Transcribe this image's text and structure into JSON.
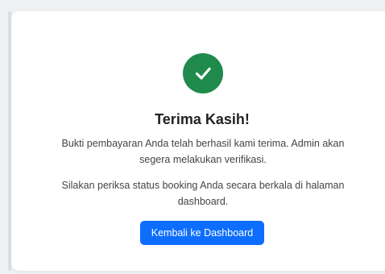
{
  "confirmation": {
    "icon": "check-circle-icon",
    "icon_color": "#1f8a4c",
    "title": "Terima Kasih!",
    "message_1": "Bukti pembayaran Anda telah berhasil kami terima. Admin akan segera melakukan verifikasi.",
    "message_2": "Silakan periksa status booking Anda secara berkala di halaman dashboard.",
    "button_label": "Kembali ke Dashboard",
    "button_color": "#0d6efd"
  }
}
